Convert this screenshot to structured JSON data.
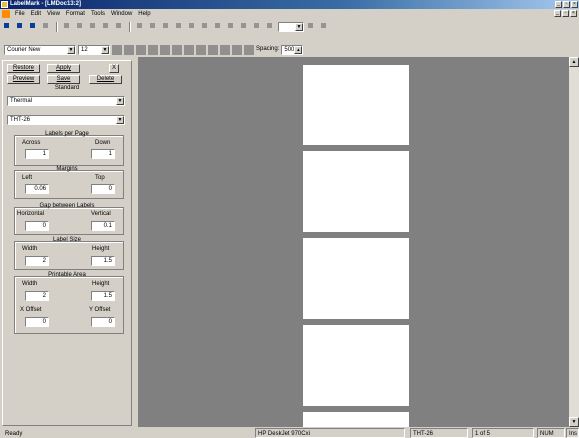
{
  "window": {
    "title": "LabelMark - [LMDoc13:2]"
  },
  "menu": [
    "File",
    "Edit",
    "View",
    "Format",
    "Tools",
    "Window",
    "Help"
  ],
  "font_toolbar": {
    "font": "Courier New",
    "size": "12",
    "spacing_label": "Spacing:",
    "spacing_value": "500"
  },
  "panel": {
    "buttons": {
      "restore": "Restore",
      "apply": "Apply",
      "close": "X",
      "preview": "Preview",
      "save": "Save",
      "delete": "Delete"
    },
    "standard_label": "Standard",
    "category": "Thermal",
    "label_type": "THT-26",
    "labels_per_page": {
      "title": "Labels per Page",
      "across_label": "Across",
      "down_label": "Down",
      "across": "1",
      "down": "1"
    },
    "margins": {
      "title": "Margins",
      "left_label": "Left",
      "top_label": "Top",
      "left": "0.06",
      "top": "0"
    },
    "gap": {
      "title": "Gap between Labels",
      "horizontal_label": "Horizontal",
      "vertical_label": "Vertical",
      "horizontal": "0",
      "vertical": "0.1"
    },
    "label_size": {
      "title": "Label Size",
      "width_label": "Width",
      "height_label": "Height",
      "width": "2",
      "height": "1.5"
    },
    "printable": {
      "title": "Printable Area",
      "width_label": "Width",
      "height_label": "Height",
      "width": "2",
      "height": "1.5",
      "xoffset_label": "X Offset",
      "yoffset_label": "Y Offset",
      "xoffset": "0",
      "yoffset": "0"
    }
  },
  "status": {
    "ready": "Ready",
    "printer": "HP DeskJet 970Cxi",
    "label": "THT-26",
    "page": "1 of 5",
    "num": "NUM",
    "ins": "Ins"
  }
}
